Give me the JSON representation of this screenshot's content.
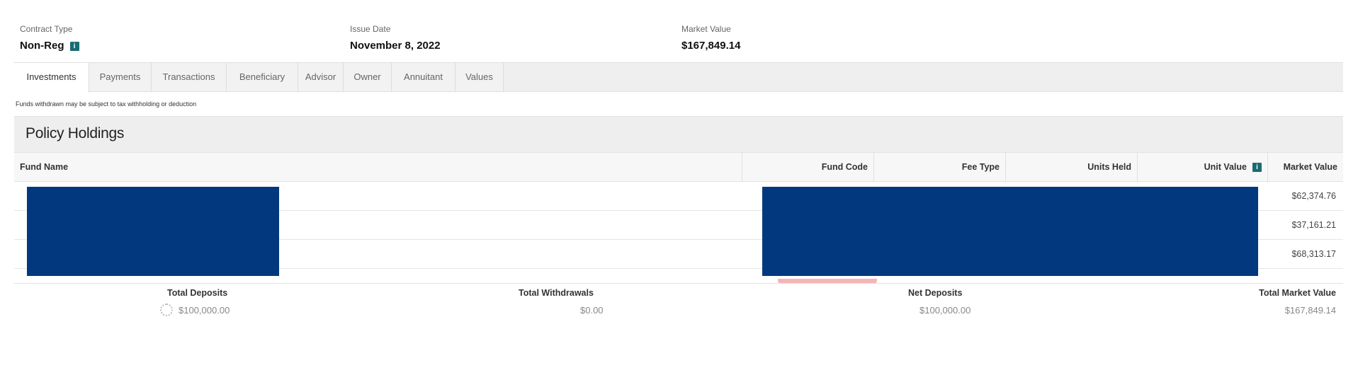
{
  "summary": {
    "contract_type_label": "Contract Type",
    "contract_type_value": "Non-Reg",
    "issue_date_label": "Issue Date",
    "issue_date_value": "November 8, 2022",
    "market_value_label": "Market Value",
    "market_value_value": "$167,849.14"
  },
  "tabs": [
    {
      "label": "Investments",
      "active": true
    },
    {
      "label": "Payments"
    },
    {
      "label": "Transactions"
    },
    {
      "label": "Beneficiary"
    },
    {
      "label": "Advisor"
    },
    {
      "label": "Owner"
    },
    {
      "label": "Annuitant"
    },
    {
      "label": "Values"
    }
  ],
  "notice": "Funds withdrawn may be subject to tax withholding or deduction",
  "holdings": {
    "title": "Policy Holdings",
    "columns": [
      "Fund Name",
      "Fund Code",
      "Fee Type",
      "Units Held",
      "Unit Value",
      "Market Value"
    ],
    "rows": [
      {
        "market_value": "$62,374.76"
      },
      {
        "market_value": "$37,161.21"
      },
      {
        "market_value": "$68,313.17"
      }
    ]
  },
  "totals": {
    "total_deposits_label": "Total Deposits",
    "total_deposits_value": "$100,000.00",
    "total_withdrawals_label": "Total Withdrawals",
    "total_withdrawals_value": "$0.00",
    "net_deposits_label": "Net Deposits",
    "net_deposits_value": "$100,000.00",
    "total_market_value_label": "Total Market Value",
    "total_market_value_value": "$167,849.14"
  },
  "colors": {
    "redaction": "#02387d",
    "info_icon": "#1b6b73"
  },
  "icons": [
    "info-icon",
    "loading-spinner-icon"
  ]
}
